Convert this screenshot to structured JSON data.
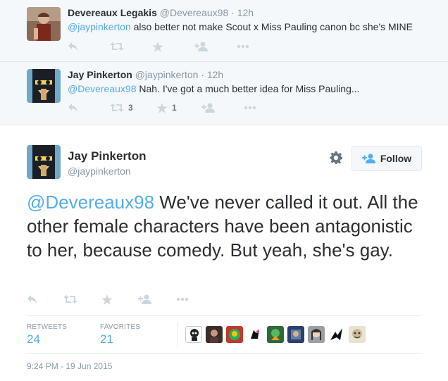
{
  "replies": [
    {
      "name": "Devereaux Legakis",
      "handle": "@Devereaux98",
      "time": "· 12h",
      "mention": "@jaypinkerton",
      "text": " also better not make Scout x Miss Pauling canon bc she's MINE",
      "retweets": "",
      "favorites": ""
    },
    {
      "name": "Jay Pinkerton",
      "handle": "@jaypinkerton",
      "time": "· 12h",
      "mention": "@Devereaux98",
      "text": " Nah. I've got a much better idea for Miss Pauling...",
      "retweets": "3",
      "favorites": "1"
    }
  ],
  "main": {
    "name": "Jay Pinkerton",
    "handle": "@jaypinkerton",
    "follow_label": "Follow",
    "mention": "@Devereaux98",
    "text": " We've never called it out. All the other female characters have been antagonistic to her, because comedy. But yeah, she's gay.",
    "retweets_label": "RETWEETS",
    "retweets": "24",
    "favorites_label": "FAVORITES",
    "favorites": "21",
    "timestamp": "9:24 PM - 19 Jun 2015"
  },
  "colors": {
    "accent": "#55acee",
    "muted": "#8899a6",
    "icon": "#ccd6dd",
    "thread_bg": "#f5f8fa"
  },
  "icons": [
    "reply-icon",
    "retweet-icon",
    "favorite-icon",
    "follow-icon",
    "more-icon",
    "gear-icon"
  ]
}
